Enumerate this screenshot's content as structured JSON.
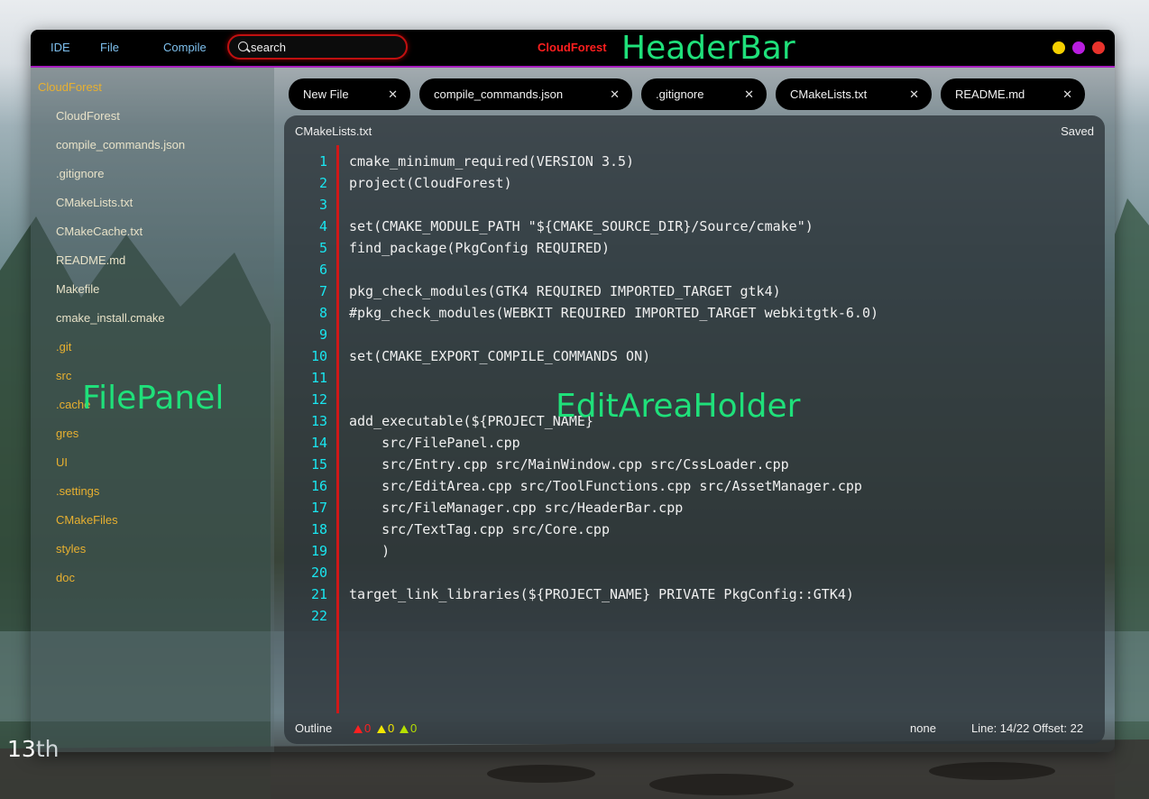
{
  "colors": {
    "header_bg": "#000000",
    "header_border": "#a51dbd",
    "nav_text": "#7ec0ee",
    "app_title": "#ff1f1f",
    "search_border": "#c01010",
    "overlay_label": "#1fe07a",
    "file_text": "#e8e2c8",
    "dir_text": "#e8b030",
    "line_number": "#19e6f0",
    "gutter": "#d01818",
    "window_minimize": "#f5d000",
    "window_maximize": "#b81ee0",
    "window_close": "#e8332c",
    "error": "#ff2020",
    "warning": "#f2e600",
    "info": "#b6e000"
  },
  "headerbar": {
    "menu": [
      "IDE",
      "File",
      "Compile"
    ],
    "search": {
      "value": "",
      "placeholder": "search",
      "icon": "search-icon"
    },
    "app_title": "CloudForest",
    "overlay_label": "HeaderBar"
  },
  "filepanel": {
    "overlay_label": "FilePanel",
    "root": "CloudForest",
    "items": [
      {
        "name": "CloudForest",
        "type": "file"
      },
      {
        "name": "compile_commands.json",
        "type": "file"
      },
      {
        "name": ".gitignore",
        "type": "file"
      },
      {
        "name": "CMakeLists.txt",
        "type": "file"
      },
      {
        "name": "CMakeCache.txt",
        "type": "file"
      },
      {
        "name": "README.md",
        "type": "file"
      },
      {
        "name": "Makefile",
        "type": "file"
      },
      {
        "name": "cmake_install.cmake",
        "type": "file"
      },
      {
        "name": ".git",
        "type": "dir"
      },
      {
        "name": "src",
        "type": "dir"
      },
      {
        "name": ".cache",
        "type": "dir"
      },
      {
        "name": "gres",
        "type": "dir"
      },
      {
        "name": "UI",
        "type": "dir"
      },
      {
        "name": ".settings",
        "type": "dir"
      },
      {
        "name": "CMakeFiles",
        "type": "dir"
      },
      {
        "name": "styles",
        "type": "dir"
      },
      {
        "name": "doc",
        "type": "dir"
      }
    ]
  },
  "tabs": [
    {
      "label": "New File",
      "close": "✕"
    },
    {
      "label": "compile_commands.json",
      "close": "✕"
    },
    {
      "label": ".gitignore",
      "close": "✕"
    },
    {
      "label": "CMakeLists.txt",
      "close": "✕"
    },
    {
      "label": "README.md",
      "close": "✕"
    }
  ],
  "editarea": {
    "overlay_label": "EditAreaHolder",
    "filename": "CMakeLists.txt",
    "status": "Saved",
    "lines": [
      "cmake_minimum_required(VERSION 3.5)",
      "project(CloudForest)",
      "",
      "set(CMAKE_MODULE_PATH \"${CMAKE_SOURCE_DIR}/Source/cmake\")",
      "find_package(PkgConfig REQUIRED)",
      "",
      "pkg_check_modules(GTK4 REQUIRED IMPORTED_TARGET gtk4)",
      "#pkg_check_modules(WEBKIT REQUIRED IMPORTED_TARGET webkitgtk-6.0)",
      "",
      "set(CMAKE_EXPORT_COMPILE_COMMANDS ON)",
      "",
      "",
      "add_executable(${PROJECT_NAME}",
      "    src/FilePanel.cpp",
      "    src/Entry.cpp src/MainWindow.cpp src/CssLoader.cpp",
      "    src/EditArea.cpp src/ToolFunctions.cpp src/AssetManager.cpp",
      "    src/FileManager.cpp src/HeaderBar.cpp",
      "    src/TextTag.cpp src/Core.cpp",
      "    )",
      "",
      "target_link_libraries(${PROJECT_NAME} PRIVATE PkgConfig::GTK4)",
      ""
    ],
    "footer": {
      "outline": "Outline",
      "errors": "0",
      "warnings": "0",
      "infos": "0",
      "language": "none",
      "position": "Line: 14/22 Offset: 22"
    }
  },
  "desktop": {
    "day": "13",
    "suffix": "th"
  }
}
